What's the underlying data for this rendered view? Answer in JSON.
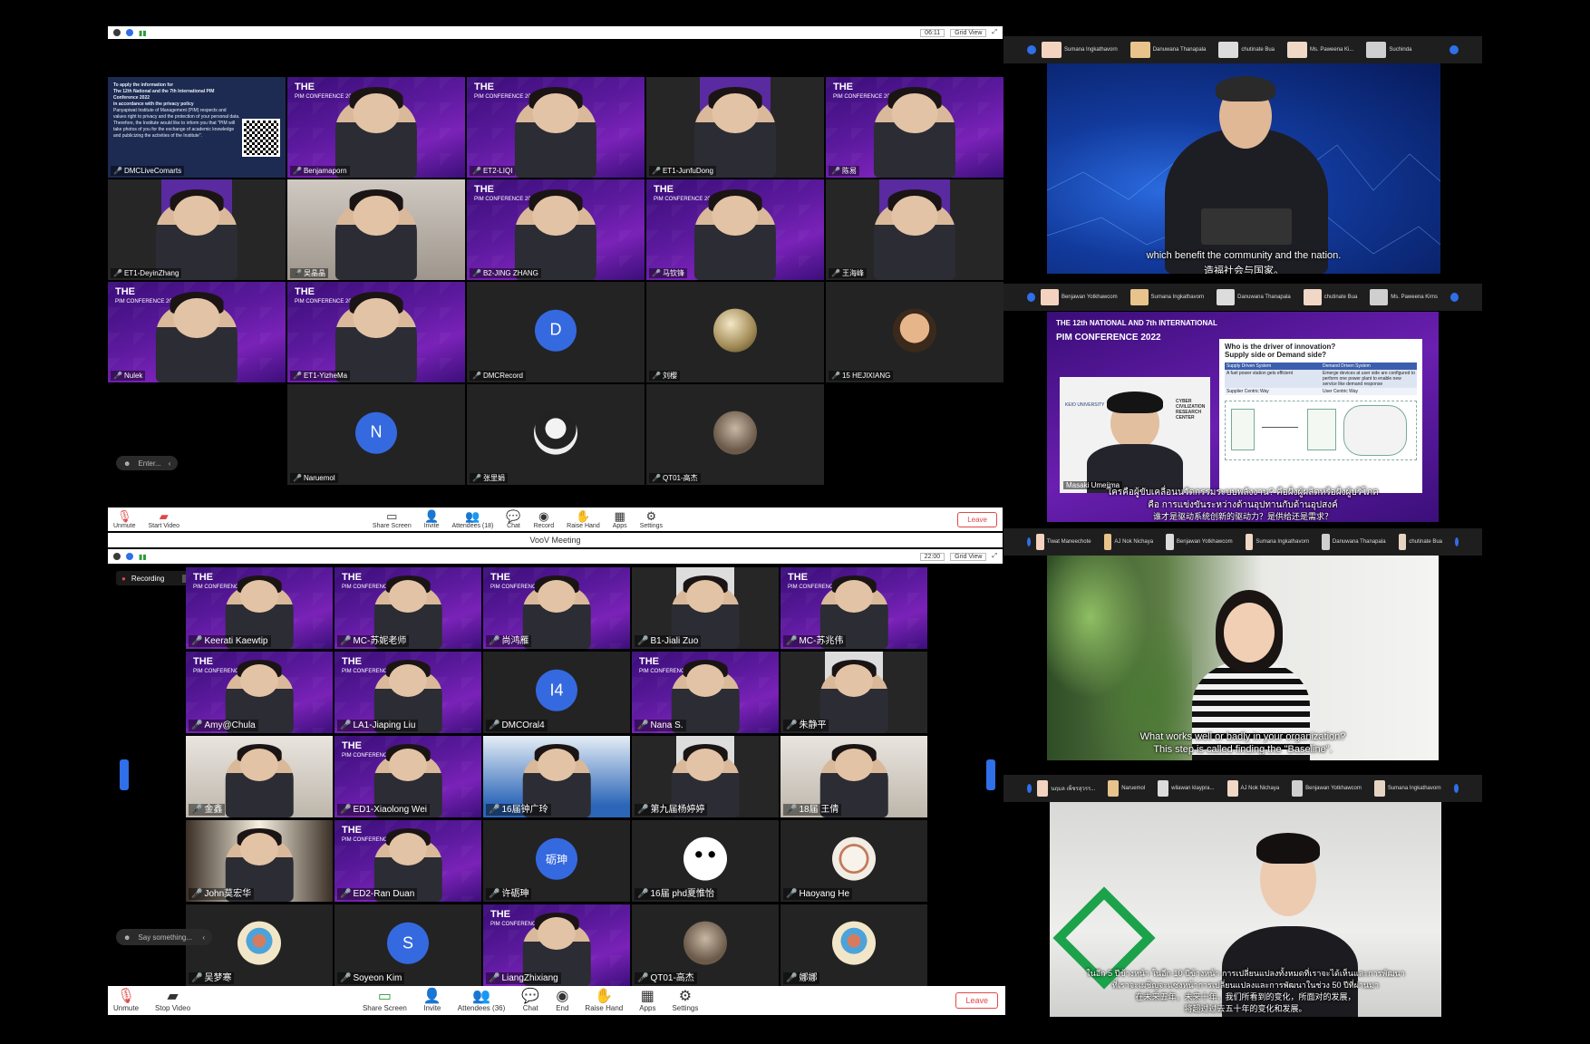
{
  "top_left": {
    "time": "06:11",
    "grid_view": "Grid View",
    "notice": {
      "line1": "To apply the information for",
      "line2": "The 12th National and the 7th International PIM Conference 2022",
      "line3": "in accordance with the privacy policy",
      "body": "Panyapiwat Institute of Management (PIM) respects and values right to privacy and the protection of your personal data. Therefore, the Institute would like to inform you that \"PIM will take photos of you for the exchange of academic knowledge and publicizing the activities of the Institute\"."
    },
    "conf_logo": {
      "title": "THE 12th NATIONAL AND 7th INTERNATIONAL",
      "sub": "PIM CONFERENCE 2022"
    },
    "chat_placeholder": "Enter...",
    "participants": [
      "DMCLiveComarts",
      "Benjamaporn",
      "ET2-LIQI",
      "ET1-JunfuDong",
      "陈易",
      "ET1-DeyinZhang",
      "吴晶晶",
      "B2-JING ZHANG",
      "马钦锋",
      "王海峰",
      "Nulek",
      "ET1-YizheMa",
      "DMCRecord",
      "刘樱",
      "15 HEJIXIANG",
      "Naruemol",
      "张里娟",
      "QT01-高杰"
    ],
    "avatars": {
      "d": "D",
      "n": "N"
    }
  },
  "bottom_left": {
    "toolbar_top": {
      "unmute": "Unmute",
      "start_video": "Start Video",
      "share_screen": "Share Screen",
      "invite": "Invite",
      "attendees": "Attendees (18)",
      "chat": "Chat",
      "record": "Record",
      "raise_hand": "Raise Hand",
      "apps": "Apps",
      "settings": "Settings",
      "leave": "Leave"
    },
    "window_title": "VooV Meeting",
    "time": "22:00",
    "grid_view": "Grid View",
    "recording": "Recording",
    "chat_placeholder": "Say something...",
    "participants": [
      "Keerati Kaewtip",
      "MC-苏妮老师",
      "尚鸿雁",
      "B1-Jiali Zuo",
      "MC-苏兆伟",
      "Amy@Chula",
      "LA1-Jiaping Liu",
      "DMCOral4",
      "Nana S.",
      "朱静平",
      "金鑫",
      "ED1-Xiaolong Wei",
      "16届钟广玲",
      "第九届杨婷婷",
      "18届 王倩",
      "John莫宏华",
      "ED2-Ran Duan",
      "许砺珅",
      "16届 phd夏惟怡",
      "Haoyang He",
      "吴梦寒",
      "Soyeon Kim",
      "LiangZhixiang",
      "QT01-高杰",
      "娜娜"
    ],
    "avatars": {
      "i4": "I4",
      "li": "砺珅",
      "s": "S"
    },
    "toolbar": {
      "unmute": "Unmute",
      "stop_video": "Stop Video",
      "share_screen": "Share Screen",
      "invite": "Invite",
      "attendees": "Attendees (36)",
      "chat": "Chat",
      "end": "End",
      "raise_hand": "Raise Hand",
      "apps": "Apps",
      "settings": "Settings",
      "leave": "Leave"
    }
  },
  "right_panels": {
    "p1": {
      "strip": [
        "Sumana Ingkathavorn",
        "Danuwana Thanapala",
        "chutinate Bua",
        "Ms. Paweena Ki...",
        "Suchinda"
      ],
      "subtitle_en": "which benefit the community and the nation.",
      "subtitle_zh": "造福社会与国家。"
    },
    "p2": {
      "strip": [
        "Benjawan Yotkhawcom",
        "Sumana Ingkathavorn",
        "Danuwana Thanapala",
        "chutinate Bua",
        "Ms. Paweena Kirns"
      ],
      "slide_question": "Who is the driver of innovation?",
      "slide_question2": "Supply side or Demand side?",
      "speaker": "Masaki Umejima",
      "center": "CYBER CIVILIZATION RESEARCH CENTER",
      "univ": "KEIO UNIVERSITY",
      "col1": "Supply Driven System",
      "col2": "Demand Driven System",
      "row1a": "A fuel power station gets efficient",
      "row1b": "Emerge devices at user side are configured to perform one power plant to enable new service like demand response",
      "row2a": "Supplier Centric Way",
      "row2b": "User Centric Way",
      "subtitle_th": "ใครคือผู้ขับเคลื่อนนวัตกรรมระบบพลังงาน? คือฝั่งผู้ผลิตหรือฝั่งผู้บริโภค",
      "subtitle_th2": "คือ การแข่งขันระหว่างด้านอุปทานกับด้านอุปสงค์",
      "subtitle_zh": "谁才是驱动系统创新的驱动力？是供给还是需求？"
    },
    "p3": {
      "strip": [
        "Tiwat Maneechote",
        "AJ Nok Nichaya",
        "Benjawan Yotkhawcom",
        "Sumana Ingkathavorn",
        "Danuwana Thanapala",
        "chutinate Bua"
      ],
      "subtitle1": "What works well or badly in your organization?",
      "subtitle2": "This step is called finding the \"Baseline\"."
    },
    "p4": {
      "strip": [
        "นฤมล เพ็ชรสุวรร...",
        "Naruemol",
        "wilawan klaypra...",
        "AJ Nok Nichaya",
        "Benjawan Yotkhawcom",
        "Sumana Ingkathavorn"
      ],
      "subtitle_th1": "ในอีก 5 ปีข้างหน้า ในอีก 10 ปีข้างหน้า การเปลี่ยนแปลงทั้งหมดที่เราจะได้เห็นและการพัฒนา",
      "subtitle_th2": "ที่เราจะเผชิญจะแซงหน้าการเปลี่ยนแปลงและการพัฒนาในช่วง 50 ปีที่ผ่านมา",
      "subtitle_zh1": "在未来五年，未来十年，我们所看到的变化，所面对的发展，",
      "subtitle_zh2": "将超过过去五十年的变化和发展。"
    }
  },
  "colors": {
    "purple": "#5c1a9e",
    "accent_blue": "#2f6fe8",
    "leave_red": "#e04848"
  }
}
